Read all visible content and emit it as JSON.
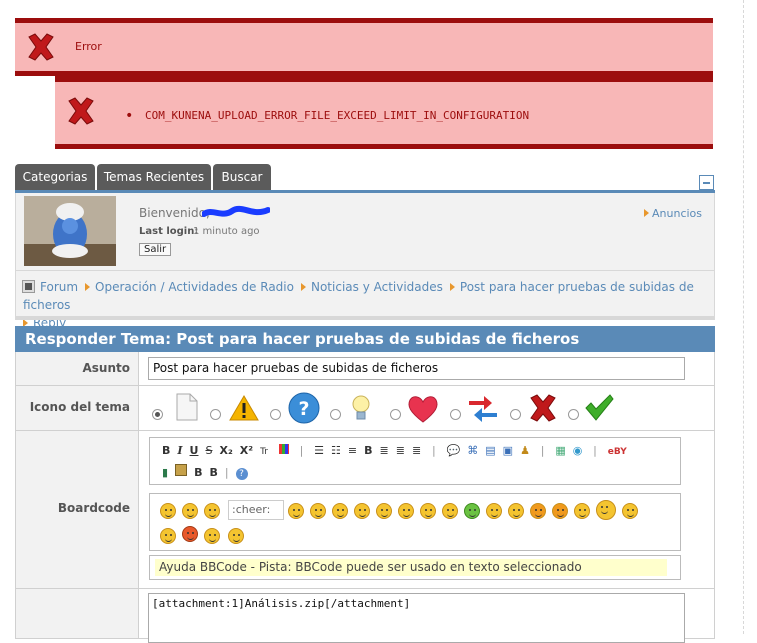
{
  "errors": {
    "title": "Error",
    "message": "COM_KUNENA_UPLOAD_ERROR_FILE_EXCEED_LIMIT_IN_CONFIGURATION"
  },
  "tabs": [
    {
      "label": "Categorias"
    },
    {
      "label": "Temas Recientes"
    },
    {
      "label": "Buscar"
    }
  ],
  "profile": {
    "welcome": "Bienvenido,",
    "last_login_label": "Last login:",
    "last_login_value": "1 minuto ago",
    "logout": "Salir",
    "announcements": "Anuncios"
  },
  "breadcrumb": {
    "items": [
      "Forum",
      "Operación / Actividades de Radio",
      "Noticias y Actividades",
      "Post para hacer pruebas de subidas de ficheros",
      "Reply"
    ]
  },
  "form": {
    "title": "Responder Tema: Post para hacer pruebas de subidas de ficheros",
    "subject_label": "Asunto",
    "subject_value": "Post para hacer pruebas de subidas de ficheros",
    "icon_label": "Icono del tema",
    "boardcode_label": "Boardcode",
    "toolbar_row1": [
      "B",
      "I",
      "U",
      "S",
      "X₂",
      "X²",
      "Tr"
    ],
    "toolbar_row2": [
      "B",
      "B"
    ],
    "broken_smiley_alt": ":cheer:",
    "help_text": "Ayuda BBCode - Pista: BBCode puede ser usado en texto seleccionado",
    "body_text": "[attachment:1]Análisis.zip[/attachment]"
  },
  "colors": {
    "error_bg": "#f8b7b7",
    "error_border": "#9c0d0d",
    "accent": "#5a8ab7",
    "tab_bg": "#5b5b5b"
  }
}
